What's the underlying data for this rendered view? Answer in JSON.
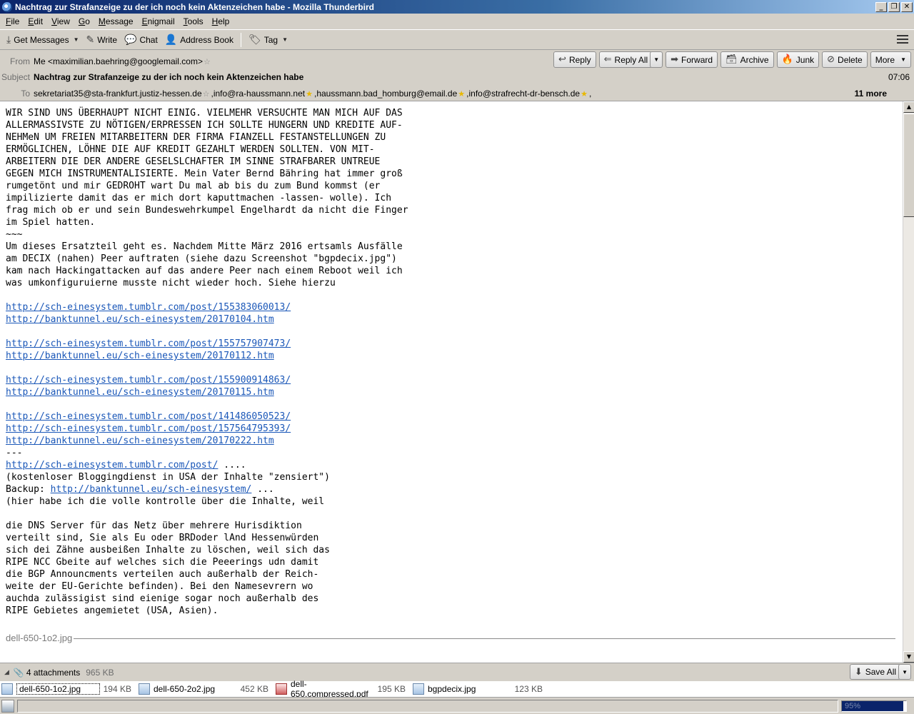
{
  "window": {
    "title": "Nachtrag zur Strafanzeige zu der ich noch kein Aktenzeichen habe - Mozilla Thunderbird"
  },
  "menu": [
    "File",
    "Edit",
    "View",
    "Go",
    "Message",
    "Enigmail",
    "Tools",
    "Help"
  ],
  "toolbar": {
    "get_messages": "Get Messages",
    "write": "Write",
    "chat": "Chat",
    "address_book": "Address Book",
    "tag": "Tag"
  },
  "header": {
    "from_label": "From",
    "from_value": "Me <maximilian.baehring@googlemail.com>",
    "subject_label": "Subject",
    "subject_value": "Nachtrag zur Strafanzeige zu der ich noch kein Aktenzeichen habe",
    "to_label": "To",
    "recipients": [
      "sekretariat35@sta-frankfurt.justiz-hessen.de",
      "info@ra-haussmann.net",
      "haussmann.bad_homburg@email.de",
      "info@strafrecht-dr-bensch.de"
    ],
    "more": "11 more",
    "time": "07:06",
    "actions": {
      "reply": "Reply",
      "reply_all": "Reply All",
      "forward": "Forward",
      "archive": "Archive",
      "junk": "Junk",
      "delete": "Delete",
      "more": "More"
    }
  },
  "body": {
    "lines": [
      {
        "text": "WIR SIND UNS ÜBERHAUPT NICHT EINIG. VIELMEHR VERSUCHTE MAN MICH AUF DAS"
      },
      {
        "text": "ALLERMASSIVSTE ZU NÖTIGEN/ERPRESSEN ICH SOLLTE HUNGERN UND KREDITE AUF-"
      },
      {
        "text": "NEHMeN UM FREIEN MITARBEITERN DER FIRMA FIANZELL FESTANSTELLUNGEN ZU"
      },
      {
        "text": "ERMÖGLICHEN, LÖHNE DIE AUF KREDIT GEZAHLT WERDEN SOLLTEN. VON MIT-"
      },
      {
        "text": "ARBEITERN DIE DER ANDERE GESELSLCHAFTER IM SINNE STRAFBARER UNTREUE"
      },
      {
        "text": "GEGEN MICH INSTRUMENTALISIERTE. Mein Vater Bernd Bähring hat immer groß"
      },
      {
        "text": "rumgetönt und mir GEDROHT wart Du mal ab bis du zum Bund kommst (er"
      },
      {
        "text": "impilizierte damit das er mich dort kaputtmachen -lassen- wolle). Ich"
      },
      {
        "text": "frag mich ob er und sein Bundeswehrkumpel Engelhardt da nicht die Finger"
      },
      {
        "text": "im Spiel hatten."
      },
      {
        "text": "~~~"
      },
      {
        "text": "Um dieses Ersatzteil geht es. Nachdem Mitte März 2016 ertsamls Ausfälle"
      },
      {
        "text": "am DECIX (nahen) Peer auftraten (siehe dazu Screenshot \"bgpdecix.jpg\")"
      },
      {
        "text": "kam nach Hackingattacken auf das andere Peer nach einem Reboot weil ich"
      },
      {
        "text": "was umkonfiguruierne musste nicht wieder hoch. Siehe hierzu"
      },
      {
        "text": ""
      },
      {
        "link": "http://sch-einesystem.tumblr.com/post/155383060013/"
      },
      {
        "link": "http://banktunnel.eu/sch-einesystem/20170104.htm"
      },
      {
        "text": ""
      },
      {
        "link": "http://sch-einesystem.tumblr.com/post/155757907473/"
      },
      {
        "link": "http://banktunnel.eu/sch-einesystem/20170112.htm"
      },
      {
        "text": ""
      },
      {
        "link": "http://sch-einesystem.tumblr.com/post/155900914863/"
      },
      {
        "link": "http://banktunnel.eu/sch-einesystem/20170115.htm"
      },
      {
        "text": ""
      },
      {
        "link": "http://sch-einesystem.tumblr.com/post/141486050523/"
      },
      {
        "link": "http://sch-einesystem.tumblr.com/post/157564795393/"
      },
      {
        "link": "http://banktunnel.eu/sch-einesystem/20170222.htm"
      },
      {
        "text": "---"
      },
      {
        "link": "http://sch-einesystem.tumblr.com/post/",
        "after": " ...."
      },
      {
        "text": "(kostenloser Bloggingdienst in USA der Inhalte \"zensiert\")"
      },
      {
        "before": "Backup: ",
        "link": "http://banktunnel.eu/sch-einesystem/",
        "after": " ..."
      },
      {
        "text": "(hier habe ich die volle kontrolle über die Inhalte, weil"
      },
      {
        "text": ""
      },
      {
        "text": "die DNS Server für das Netz über mehrere Hurisdiktion"
      },
      {
        "text": "verteilt sind, Sie als Eu oder BRDoder lAnd Hessenwürden"
      },
      {
        "text": "sich dei Zähne ausbeißen Inhalte zu löschen, weil sich das"
      },
      {
        "text": "RIPE NCC Gbeite auf welches sich die Peeerings udn damit"
      },
      {
        "text": "die BGP Announcments verteilen auch außerhalb der Reich-"
      },
      {
        "text": "weite der EU-Gerichte befinden). Bei den Namesevrern wo"
      },
      {
        "text": "auchda zulässigist sind eienige sogar noch außerhalb des"
      },
      {
        "text": "RIPE Gebietes angemietet (USA, Asien)."
      }
    ],
    "attachment_separator": "dell-650-1o2.jpg"
  },
  "attachments": {
    "summary": "4 attachments",
    "total_size": "965 KB",
    "save_all": "Save All",
    "items": [
      {
        "name": "dell-650-1o2.jpg",
        "size": "194 KB",
        "type": "image"
      },
      {
        "name": "dell-650-2o2.jpg",
        "size": "452 KB",
        "type": "image"
      },
      {
        "name": "dell-650.compressed.pdf",
        "size": "195 KB",
        "type": "pdf"
      },
      {
        "name": "bgpdecix.jpg",
        "size": "123 KB",
        "type": "image"
      }
    ]
  },
  "status": {
    "progress_percent": 95,
    "progress_text": "95%"
  }
}
